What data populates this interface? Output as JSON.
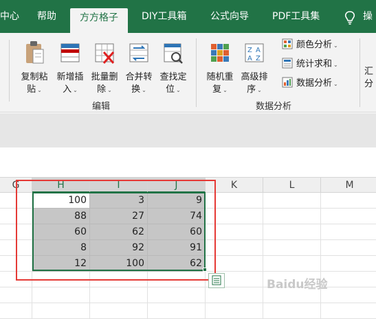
{
  "tabs": [
    {
      "label": "中心",
      "active": false
    },
    {
      "label": "帮助",
      "active": false
    },
    {
      "label": "方方格子",
      "active": true
    },
    {
      "label": "DIY工具箱",
      "active": false
    },
    {
      "label": "公式向导",
      "active": false
    },
    {
      "label": "PDF工具集",
      "active": false
    },
    {
      "label": "操",
      "active": false
    }
  ],
  "ribbon": {
    "edit_group": {
      "label": "编辑",
      "buttons": [
        {
          "line1": "复制粘",
          "line2": "贴",
          "icon": "clipboard-icon"
        },
        {
          "line1": "新增插",
          "line2": "入",
          "icon": "insert-row-icon"
        },
        {
          "line1": "批量删",
          "line2": "除",
          "icon": "delete-grid-icon"
        },
        {
          "line1": "合并转",
          "line2": "换",
          "icon": "merge-convert-icon"
        },
        {
          "line1": "查找定",
          "line2": "位",
          "icon": "find-locate-icon"
        }
      ]
    },
    "analysis_group": {
      "label": "数据分析",
      "buttons": [
        {
          "line1": "随机重",
          "line2": "复",
          "icon": "random-repeat-icon"
        },
        {
          "line1": "高级排",
          "line2": "序",
          "icon": "advanced-sort-icon"
        }
      ],
      "small_items": [
        {
          "label": "颜色分析",
          "icon": "color-analysis-icon"
        },
        {
          "label": "统计求和",
          "icon": "sum-stats-icon"
        },
        {
          "label": "数据分析",
          "icon": "data-analysis-icon"
        }
      ]
    },
    "partial_button": {
      "line1": "汇",
      "line2": "分"
    }
  },
  "colors": {
    "accent": "#217346",
    "highlight": "#e53935"
  },
  "grid": {
    "columns": [
      "G",
      "H",
      "I",
      "J",
      "K",
      "L",
      "M"
    ],
    "selected_columns": [
      "H",
      "I",
      "J"
    ],
    "rows": [
      [
        100,
        3,
        9
      ],
      [
        88,
        27,
        74
      ],
      [
        60,
        62,
        60
      ],
      [
        8,
        92,
        91
      ],
      [
        12,
        100,
        62
      ]
    ]
  },
  "watermark": "Baidu经验"
}
